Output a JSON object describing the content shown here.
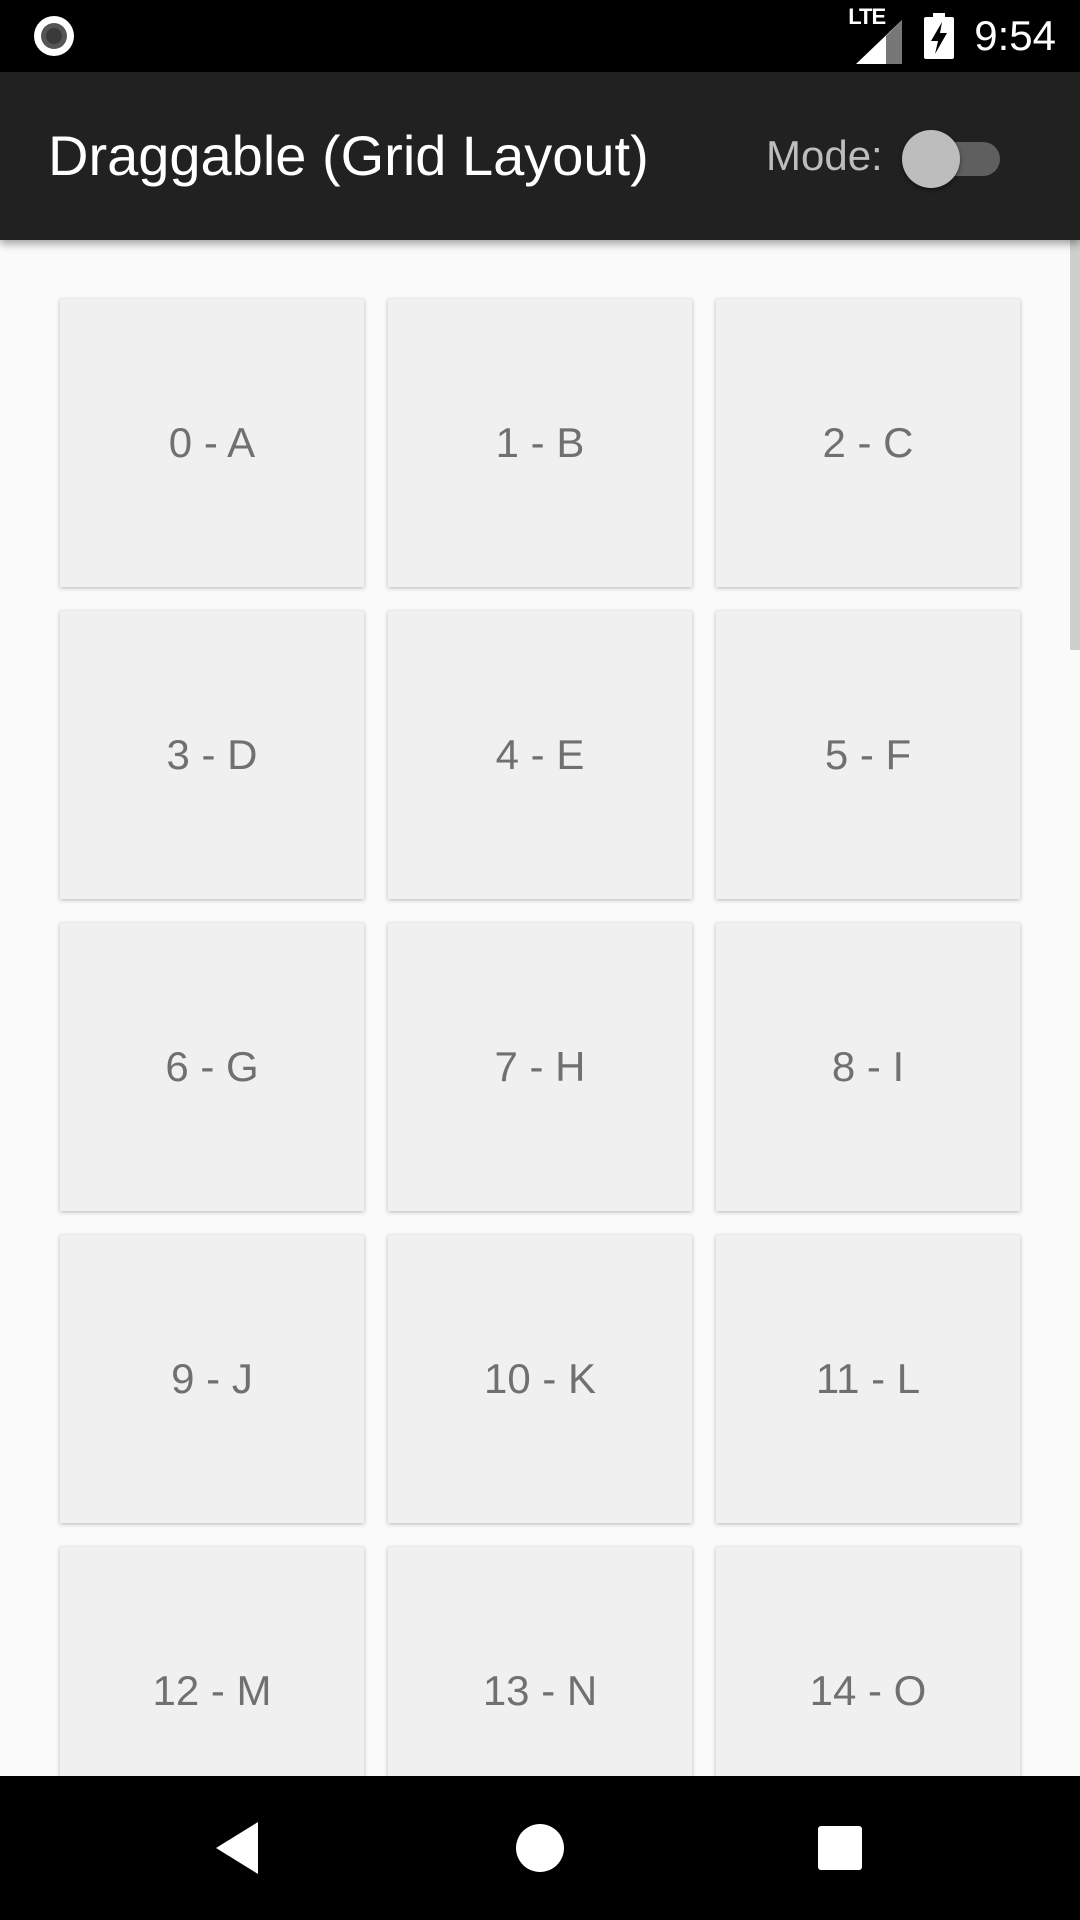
{
  "status_bar": {
    "left_icon": "recording-circle-icon",
    "network_label": "LTE",
    "signal_icon": "signal-icon",
    "battery_icon": "battery-charging-icon",
    "time": "9:54"
  },
  "app_bar": {
    "title": "Draggable (Grid Layout)",
    "mode_label": "Mode:",
    "mode_switch_on": false
  },
  "grid": {
    "columns": 3,
    "items": [
      {
        "label": "0 - A"
      },
      {
        "label": "1 - B"
      },
      {
        "label": "2 - C"
      },
      {
        "label": "3 - D"
      },
      {
        "label": "4 - E"
      },
      {
        "label": "5 - F"
      },
      {
        "label": "6 - G"
      },
      {
        "label": "7 - H"
      },
      {
        "label": "8 - I"
      },
      {
        "label": "9 - J"
      },
      {
        "label": "10 - K"
      },
      {
        "label": "11 - L"
      },
      {
        "label": "12 - M"
      },
      {
        "label": "13 - N"
      },
      {
        "label": "14 - O"
      }
    ]
  },
  "nav_bar": {
    "back_icon": "back-triangle-icon",
    "home_icon": "home-circle-icon",
    "recents_icon": "recents-square-icon"
  },
  "colors": {
    "status_bar": "#000000",
    "app_bar": "#212121",
    "background": "#fafafa",
    "tile": "#f0f0f0",
    "tile_text": "#707070"
  }
}
